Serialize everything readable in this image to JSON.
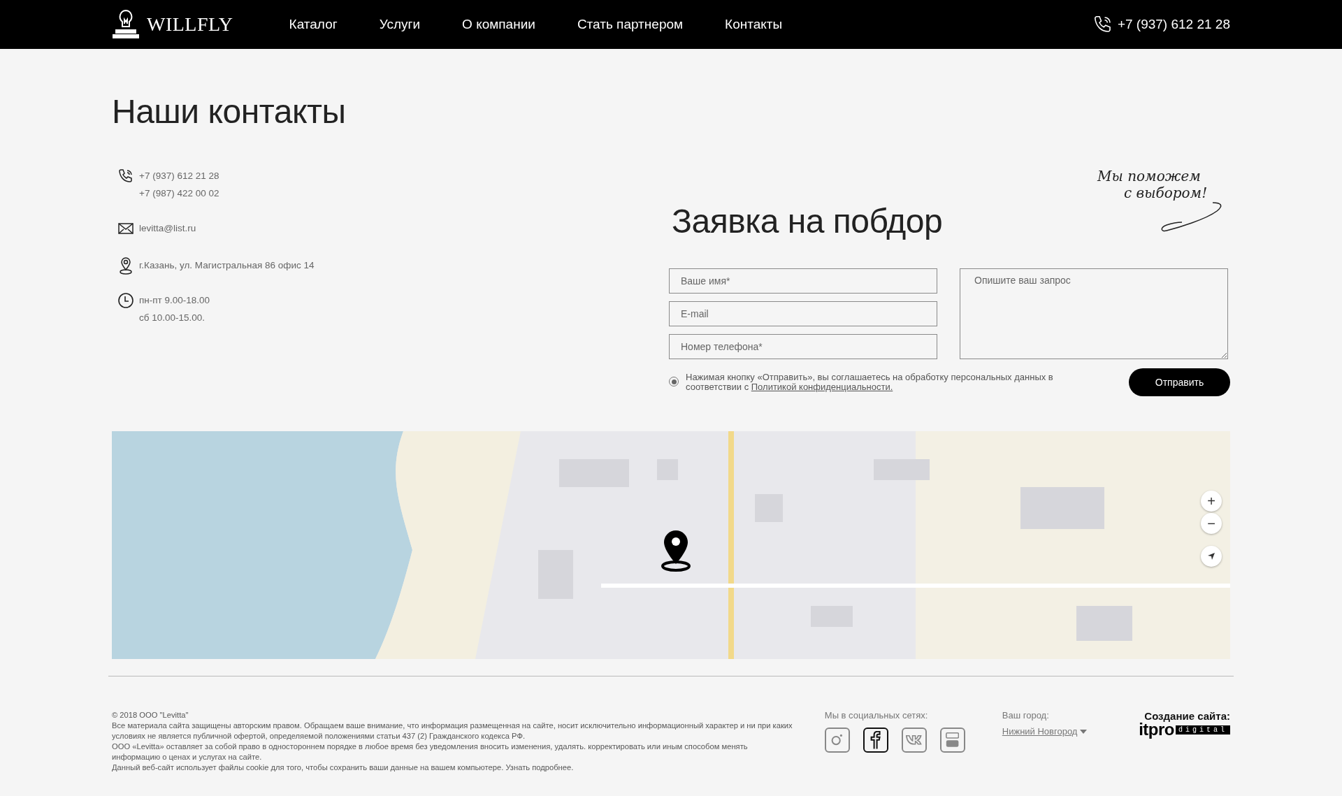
{
  "header": {
    "logo": "WILLFLY",
    "nav": [
      {
        "label": "Каталог"
      },
      {
        "label": "Услуги"
      },
      {
        "label": "О компании"
      },
      {
        "label": "Стать партнером"
      },
      {
        "label": "Контакты"
      }
    ],
    "phone": "+7 (937) 612 21 28"
  },
  "contacts": {
    "title": "Наши контакты",
    "items": [
      {
        "kind": "phone",
        "lines": [
          "+7 (937) 612 21 28",
          "+7 (987) 422 00 02"
        ]
      },
      {
        "kind": "email",
        "lines": [
          "levitta@list.ru"
        ]
      },
      {
        "kind": "address",
        "lines": [
          "г.Казань, ул. Магистральная 86 офис 14"
        ]
      },
      {
        "kind": "hours",
        "lines": [
          "пн-пт 9.00-18.00",
          "сб 10.00-15.00."
        ]
      }
    ]
  },
  "form": {
    "title": "Заявка на побдор",
    "tagline": [
      "Мы поможем",
      "с выбором!"
    ],
    "fields": [
      {
        "placeholder": "Ваше имя*"
      },
      {
        "placeholder": "E-mail"
      },
      {
        "placeholder": "Номер телефона*"
      }
    ],
    "textarea": {
      "placeholder": "Опишите ваш запрос"
    },
    "consent": {
      "checked": true,
      "text": "Нажимая кнопку «Отправить», вы соглашаетесь на обработку персональных данных в соответствии с",
      "link": "Политикой конфиденциальности."
    },
    "submit": "Отправить"
  },
  "map": {
    "zoom_in": "+",
    "zoom_out": "−"
  },
  "footer": {
    "legal": [
      "© 2018 ООО \"Levitta\"",
      "Все материала сайта защищены авторским правом. Обращаем ваше внимание, что информация размещенная на сайте, носит исключительно информационный характер и ни при каких условиях не является публичной офертой, определяемой положениями статьи 437 (2) Гражданского кодекса РФ.",
      "ООО «Levitta» оставляет за собой право в одностороннем порядке в любое время без уведомления вносить изменения, удалять. корректировать или иным способом менять информацию о ценах и услугах на сайте.",
      "Данный веб-сайт использует файлы cookie для того, чтобы сохранить ваши данные на вашем компьютере. Узнать подробнее."
    ],
    "social_label": "Мы в социальных сетях:",
    "social": [
      {
        "kind": "instagram",
        "hovered": false
      },
      {
        "kind": "facebook",
        "hovered": true
      },
      {
        "kind": "vk",
        "hovered": false
      },
      {
        "kind": "youtube",
        "hovered": false
      }
    ],
    "city_label": "Ваш город:",
    "city": "Нижний Новгород",
    "credit_label": "Создание сайта:",
    "credit_brand": "itpro",
    "credit_tag": "digital"
  }
}
